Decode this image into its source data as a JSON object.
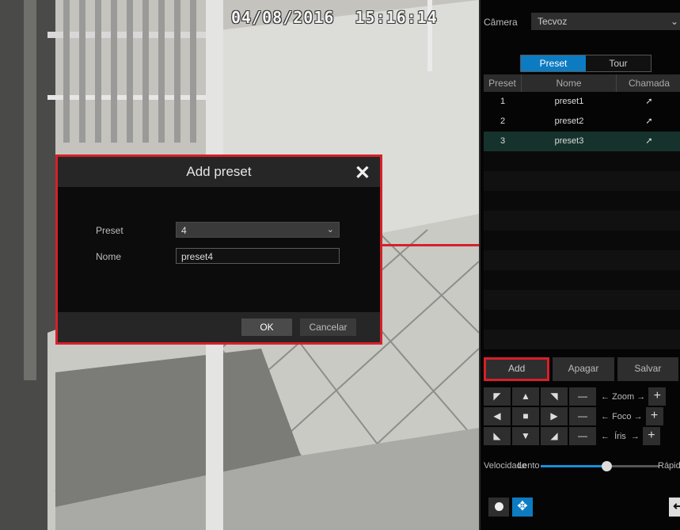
{
  "osd": {
    "datetime": "04/08/2016  15:16:14"
  },
  "dialog": {
    "title": "Add preset",
    "preset_label": "Preset",
    "preset_value": "4",
    "nome_label": "Nome",
    "nome_value": "preset4",
    "ok_label": "OK",
    "cancel_label": "Cancelar"
  },
  "panel": {
    "camera_label": "Câmera",
    "camera_value": "Tecvoz",
    "tabs": [
      {
        "label": "Preset",
        "active": true
      },
      {
        "label": "Tour",
        "active": false
      }
    ],
    "table": {
      "headers": [
        "Preset",
        "Nome",
        "Chamada"
      ],
      "rows": [
        {
          "preset": "1",
          "nome": "preset1"
        },
        {
          "preset": "2",
          "nome": "preset2"
        },
        {
          "preset": "3",
          "nome": "preset3",
          "selected": true
        }
      ]
    },
    "actions": {
      "add": "Add",
      "delete": "Apagar",
      "save": "Salvar"
    },
    "ptz": {
      "zoom": "Zoom",
      "focus": "Foco",
      "iris": "Íris"
    },
    "speed": {
      "label": "Velocidade",
      "slow": "Lento",
      "fast": "Rápido",
      "level": 0.55
    }
  },
  "colors": {
    "accent": "#0d7bc2",
    "highlight": "#d6202a"
  }
}
